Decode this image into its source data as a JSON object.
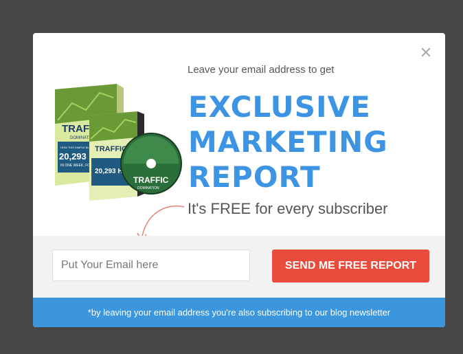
{
  "popup": {
    "intro": "Leave your email address to get",
    "headline": [
      "EXCLUSIVE",
      "MARKETING",
      "REPORT"
    ],
    "subline": "It's FREE for every subscriber",
    "close_icon": "close-icon"
  },
  "product": {
    "box_title": "TRAFFIC",
    "box_subtitle": "DOMINATION",
    "box_tagline": "HOW THIS SIMPLE BLOG POST GOT",
    "box_stat": "20,293 HITS",
    "box_note": "IN ONE WEEK, FOR FREE!",
    "disc_title": "TRAFFIC",
    "disc_subtitle": "DOMINATION"
  },
  "form": {
    "email_placeholder": "Put Your Email here",
    "submit_label": "SEND ME FREE REPORT"
  },
  "footer": {
    "note": "*by leaving your email address you're also subscribing to our blog newsletter"
  },
  "colors": {
    "overlay": "#464646",
    "accent_blue": "#3d94e3",
    "button_red": "#e74c3c",
    "footer_blue": "#3b96dd"
  }
}
